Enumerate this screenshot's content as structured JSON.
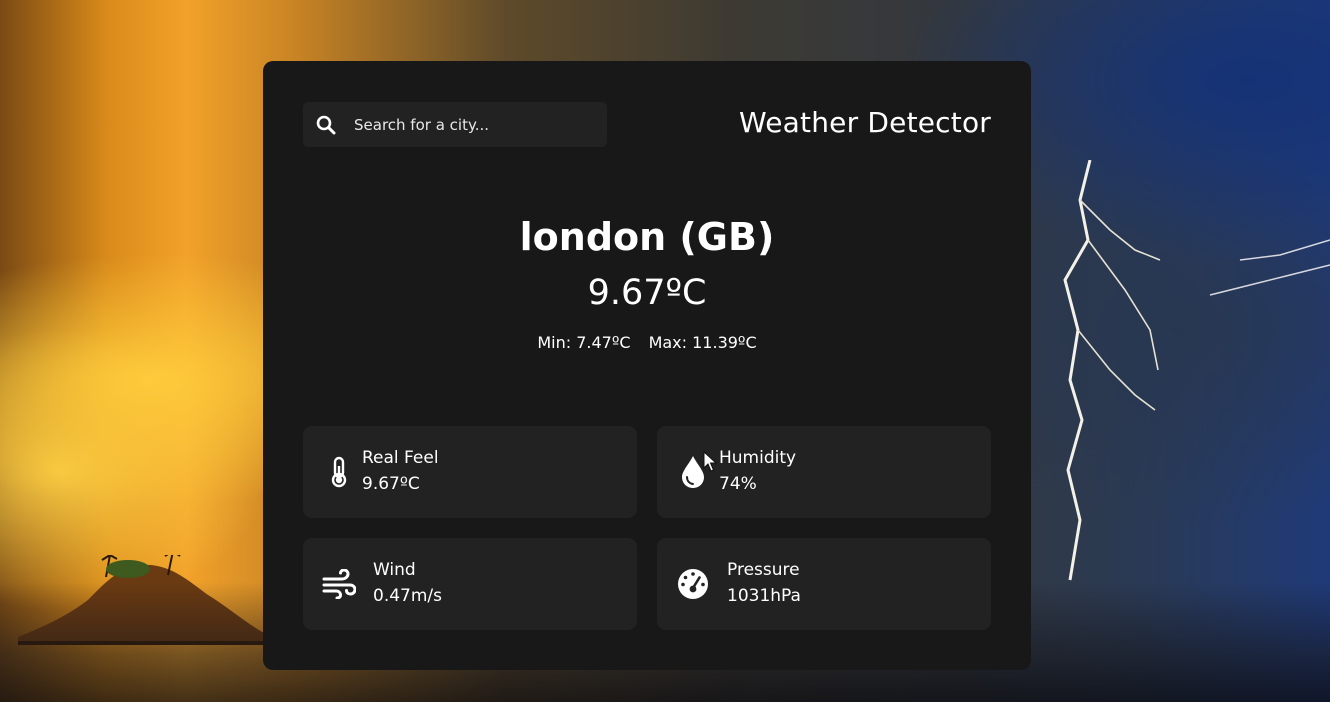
{
  "search": {
    "placeholder": "Search for a city...",
    "icon": "search-icon"
  },
  "header": {
    "title": "Weather Detector"
  },
  "weather": {
    "city": "london (GB)",
    "temperature": "9.67ºC",
    "min": "Min: 7.47ºC",
    "max": "Max: 11.39ºC"
  },
  "details": {
    "real_feel": {
      "label": "Real Feel",
      "value": "9.67ºC",
      "icon": "thermometer-icon"
    },
    "humidity": {
      "label": "Humidity",
      "value": "74%",
      "icon": "water-drop-icon"
    },
    "wind": {
      "label": "Wind",
      "value": "0.47m/s",
      "icon": "wind-icon"
    },
    "pressure": {
      "label": "Pressure",
      "value": "1031hPa",
      "icon": "gauge-icon"
    }
  },
  "colors": {
    "card_background": "#181818",
    "tile_background": "#222222",
    "text": "#ffffff"
  }
}
